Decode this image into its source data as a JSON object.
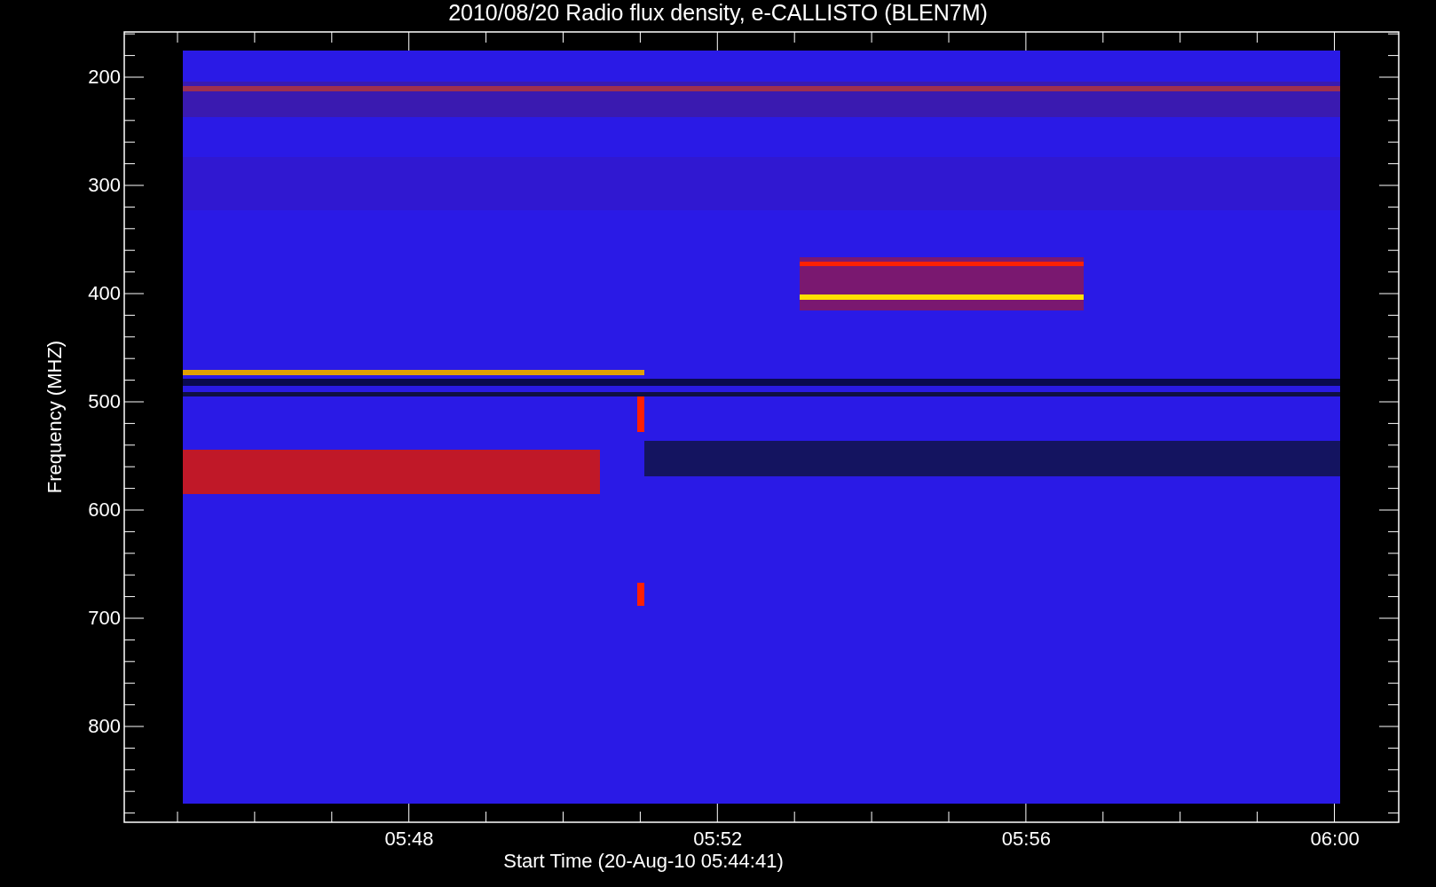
{
  "title": "2010/08/20  Radio flux density, e-CALLISTO (BLEN7M)",
  "y_axis": {
    "label": "Frequency (MHZ)",
    "ticks": [
      "200",
      "300",
      "400",
      "500",
      "600",
      "700",
      "800"
    ]
  },
  "x_axis": {
    "label": "Start Time (20-Aug-10 05:44:41)",
    "ticks": [
      "05:48",
      "05:52",
      "05:56",
      "06:00"
    ]
  }
}
